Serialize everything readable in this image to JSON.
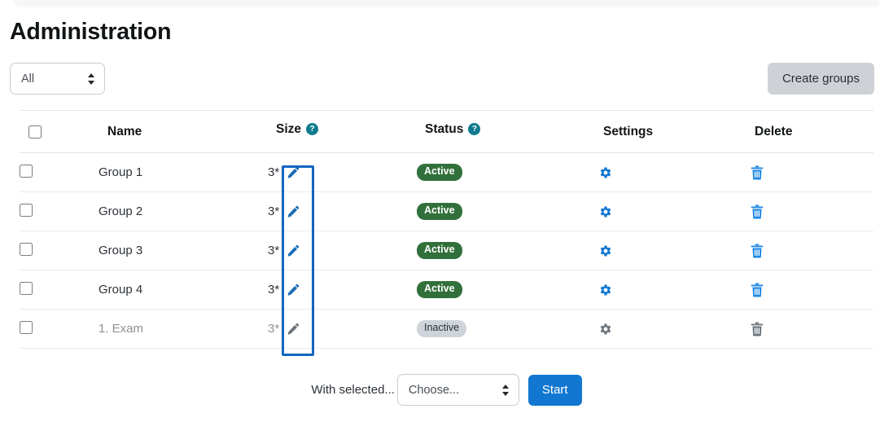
{
  "page": {
    "title": "Administration"
  },
  "toolbar": {
    "filter_select": {
      "value": "All",
      "options": [
        "All"
      ]
    },
    "create_groups_label": "Create groups"
  },
  "table": {
    "columns": [
      {
        "key": "select",
        "label": "",
        "help": false
      },
      {
        "key": "name",
        "label": "Name",
        "help": false
      },
      {
        "key": "size",
        "label": "Size",
        "help": true
      },
      {
        "key": "status",
        "label": "Status",
        "help": true
      },
      {
        "key": "settings",
        "label": "Settings",
        "help": false
      },
      {
        "key": "delete",
        "label": "Delete",
        "help": false
      }
    ],
    "help_glyph": "?",
    "rows": [
      {
        "name": "Group 1",
        "size": "3*",
        "status": "Active",
        "state": "active",
        "checked": false
      },
      {
        "name": "Group 2",
        "size": "3*",
        "status": "Active",
        "state": "active",
        "checked": false
      },
      {
        "name": "Group 3",
        "size": "3*",
        "status": "Active",
        "state": "active",
        "checked": false
      },
      {
        "name": "Group 4",
        "size": "3*",
        "status": "Active",
        "state": "active",
        "checked": false
      },
      {
        "name": "1. Exam",
        "size": "3*",
        "status": "Inactive",
        "state": "inactive",
        "checked": false
      }
    ]
  },
  "footer": {
    "with_selected_label": "With selected...",
    "bulk_select": {
      "value": "Choose...",
      "options": [
        "Choose..."
      ]
    },
    "start_label": "Start"
  },
  "icons": {
    "edit": "pencil-icon",
    "settings": "gear-icon",
    "delete": "trash-icon",
    "help": "help-circle-icon",
    "select_arrows": "sort-arrows-icon"
  },
  "colors": {
    "primary": "#1177d1",
    "edit_icon": "#1a6cb5",
    "settings_icon": "#1177d1",
    "delete_icon": "#1e88e5",
    "disabled_icon": "#6c757d",
    "badge_active_bg": "#31703a",
    "badge_inactive_bg": "#ced4da",
    "help_badge_bg": "#0f7b8e",
    "highlight_border": "#1565c0",
    "create_button_bg": "#ced2d6"
  },
  "annotation": {
    "highlight_target": "size-edit-column"
  }
}
